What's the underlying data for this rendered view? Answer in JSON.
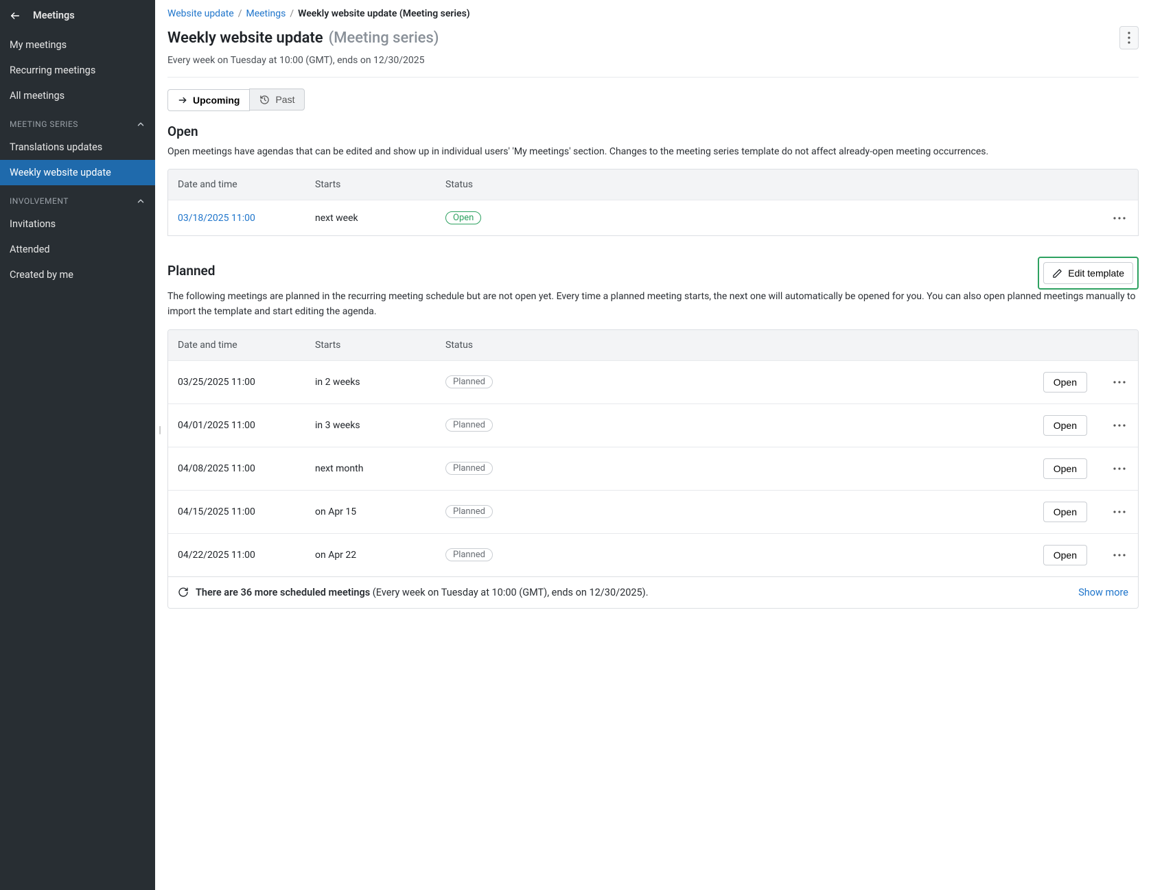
{
  "sidebar": {
    "title": "Meetings",
    "nav": [
      {
        "label": "My meetings"
      },
      {
        "label": "Recurring meetings"
      },
      {
        "label": "All meetings"
      }
    ],
    "groups": [
      {
        "header": "MEETING SERIES",
        "items": [
          {
            "label": "Translations updates",
            "active": false
          },
          {
            "label": "Weekly website update",
            "active": true
          }
        ]
      },
      {
        "header": "INVOLVEMENT",
        "items": [
          {
            "label": "Invitations"
          },
          {
            "label": "Attended"
          },
          {
            "label": "Created by me"
          }
        ]
      }
    ]
  },
  "breadcrumbs": {
    "a": "Website update",
    "b": "Meetings",
    "current": "Weekly website update (Meeting series)"
  },
  "page": {
    "title": "Weekly website update",
    "title_suffix": "(Meeting series)",
    "subtitle": "Every week on Tuesday at 10:00 (GMT), ends on 12/30/2025"
  },
  "tabs": {
    "upcoming": "Upcoming",
    "past": "Past"
  },
  "open_section": {
    "title": "Open",
    "desc": "Open meetings have agendas that can be edited and show up in individual users' 'My meetings' section. Changes to the meeting series template do not affect already-open meeting occurrences.",
    "columns": {
      "dt": "Date and time",
      "starts": "Starts",
      "status": "Status"
    },
    "rows": [
      {
        "dt": "03/18/2025 11:00",
        "starts": "next week",
        "status": "Open"
      }
    ]
  },
  "planned_section": {
    "title": "Planned",
    "edit_label": "Edit template",
    "desc": "The following meetings are planned in the recurring meeting schedule but are not open yet. Every time a planned meeting starts, the next one will automatically be opened for you. You can also open planned meetings manually to import the template and start editing the agenda.",
    "columns": {
      "dt": "Date and time",
      "starts": "Starts",
      "status": "Status"
    },
    "open_btn": "Open",
    "rows": [
      {
        "dt": "03/25/2025 11:00",
        "starts": "in 2 weeks",
        "status": "Planned"
      },
      {
        "dt": "04/01/2025 11:00",
        "starts": "in 3 weeks",
        "status": "Planned"
      },
      {
        "dt": "04/08/2025 11:00",
        "starts": "next month",
        "status": "Planned"
      },
      {
        "dt": "04/15/2025 11:00",
        "starts": "on Apr 15",
        "status": "Planned"
      },
      {
        "dt": "04/22/2025 11:00",
        "starts": "on Apr 22",
        "status": "Planned"
      }
    ],
    "footer_main": "There are 36 more scheduled meetings ",
    "footer_paren": "(Every week on Tuesday at 10:00 (GMT), ends on 12/30/2025).",
    "show_more": "Show more"
  }
}
